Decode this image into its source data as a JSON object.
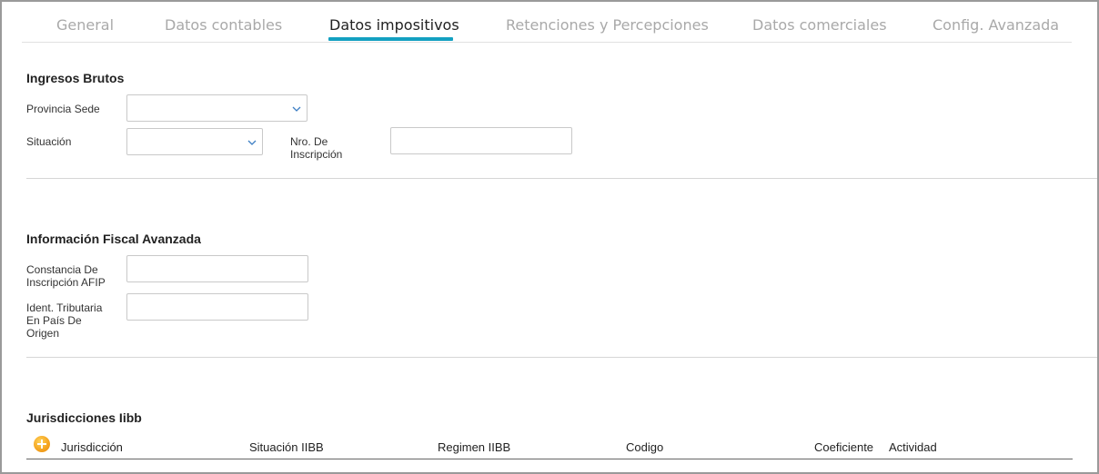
{
  "tabs": [
    {
      "label": "General"
    },
    {
      "label": "Datos contables"
    },
    {
      "label": "Datos impositivos"
    },
    {
      "label": "Retenciones y Percepciones"
    },
    {
      "label": "Datos comerciales"
    },
    {
      "label": "Config. Avanzada"
    }
  ],
  "active_tab": "Datos impositivos",
  "accent_color": "#13a0c1",
  "ingresos_brutos": {
    "title": "Ingresos Brutos",
    "provincia_label": "Provincia Sede",
    "provincia_value": "",
    "situacion_label": "Situación",
    "situacion_value": "",
    "nro_inscripcion_label_1": "Nro. De",
    "nro_inscripcion_label_2": "Inscripción",
    "nro_inscripcion_value": ""
  },
  "fiscal_avanzada": {
    "title": "Información Fiscal Avanzada",
    "constancia_label_1": "Constancia De",
    "constancia_label_2": "Inscripción AFIP",
    "constancia_value": "",
    "ident_label_1": "Ident. Tributaria",
    "ident_label_2": "En País De",
    "ident_label_3": "Origen",
    "ident_value": ""
  },
  "jurisdicciones": {
    "title": "Jurisdicciones Iibb",
    "add_icon": "plus-circle-icon",
    "columns": [
      "Jurisdicción",
      "Situación IIBB",
      "Regimen IIBB",
      "Codigo",
      "Coeficiente",
      "Actividad"
    ],
    "rows": []
  }
}
